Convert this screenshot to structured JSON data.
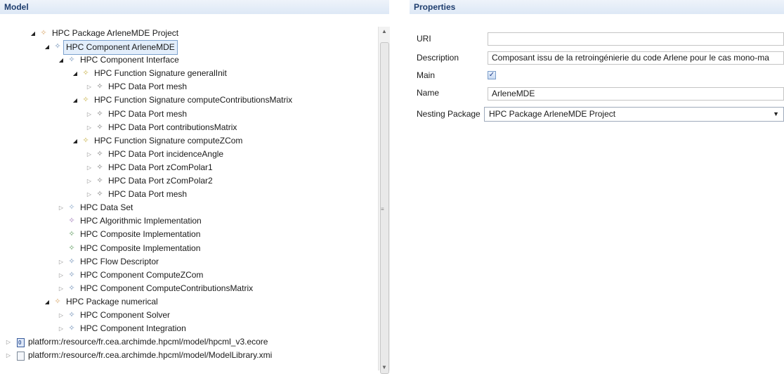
{
  "model_panel": {
    "title": "Model"
  },
  "properties_panel": {
    "title": "Properties",
    "uri": {
      "label": "URI",
      "value": ""
    },
    "description": {
      "label": "Description",
      "value": "Composant issu de la retroingénierie du code Arlene pour le cas mono-ma"
    },
    "main": {
      "label": "Main",
      "checked": true,
      "check_glyph": "✓"
    },
    "name": {
      "label": "Name",
      "value": "ArleneMDE"
    },
    "nesting_package": {
      "label": "Nesting Package",
      "value": "HPC Package ArleneMDE Project",
      "arrow": "▼"
    }
  },
  "tree": [
    {
      "label": "HPC Package ArleneMDE Project",
      "indent": 0,
      "twisty": "open",
      "icon": "package-icon",
      "color": "#d9a86c"
    },
    {
      "label": "HPC Component ArleneMDE",
      "indent": 1,
      "twisty": "open",
      "icon": "component-icon",
      "color": "#6f8fb6",
      "selected": true
    },
    {
      "label": "HPC Component Interface",
      "indent": 2,
      "twisty": "open",
      "icon": "interface-icon",
      "color": "#6f8fb6"
    },
    {
      "label": "HPC Function Signature generalInit",
      "indent": 3,
      "twisty": "open",
      "icon": "signature-icon",
      "color": "#c9b24a"
    },
    {
      "label": "HPC Data Port mesh",
      "indent": 4,
      "twisty": "closed",
      "icon": "port-icon",
      "color": "#7a7a7a"
    },
    {
      "label": "HPC Function Signature computeContributionsMatrix",
      "indent": 3,
      "twisty": "open",
      "icon": "signature-icon",
      "color": "#c9b24a"
    },
    {
      "label": "HPC Data Port mesh",
      "indent": 4,
      "twisty": "closed",
      "icon": "port-icon",
      "color": "#7a7a7a"
    },
    {
      "label": "HPC Data Port contributionsMatrix",
      "indent": 4,
      "twisty": "closed",
      "icon": "port-icon",
      "color": "#7a7a7a"
    },
    {
      "label": "HPC Function Signature computeZCom",
      "indent": 3,
      "twisty": "open",
      "icon": "signature-icon",
      "color": "#c9b24a"
    },
    {
      "label": "HPC Data Port incidenceAngle",
      "indent": 4,
      "twisty": "closed",
      "icon": "port-icon",
      "color": "#7a7a7a"
    },
    {
      "label": "HPC Data Port zComPolar1",
      "indent": 4,
      "twisty": "closed",
      "icon": "port-icon",
      "color": "#7a7a7a"
    },
    {
      "label": "HPC Data Port zComPolar2",
      "indent": 4,
      "twisty": "closed",
      "icon": "port-icon",
      "color": "#7a7a7a"
    },
    {
      "label": "HPC Data Port mesh",
      "indent": 4,
      "twisty": "closed",
      "icon": "port-icon",
      "color": "#7a7a7a"
    },
    {
      "label": "HPC Data Set",
      "indent": 2,
      "twisty": "closed",
      "icon": "dataset-icon",
      "color": "#8aa6c8"
    },
    {
      "label": "HPC Algorithmic Implementation",
      "indent": 2,
      "twisty": "none",
      "icon": "algorithmic-icon",
      "color": "#a07ab8"
    },
    {
      "label": "HPC Composite Implementation",
      "indent": 2,
      "twisty": "none",
      "icon": "composite-icon",
      "color": "#5f9a5f"
    },
    {
      "label": "HPC Composite Implementation",
      "indent": 2,
      "twisty": "none",
      "icon": "composite-icon",
      "color": "#5f9a5f"
    },
    {
      "label": "HPC Flow Descriptor",
      "indent": 2,
      "twisty": "closed",
      "icon": "flow-icon",
      "color": "#6f8fb6"
    },
    {
      "label": "HPC Component ComputeZCom",
      "indent": 2,
      "twisty": "closed",
      "icon": "component-icon",
      "color": "#6f8fb6"
    },
    {
      "label": "HPC Component ComputeContributionsMatrix",
      "indent": 2,
      "twisty": "closed",
      "icon": "component-icon",
      "color": "#6f8fb6"
    },
    {
      "label": "HPC Package numerical",
      "indent": 1,
      "twisty": "open",
      "icon": "package-icon",
      "color": "#d9a86c"
    },
    {
      "label": "HPC Component Solver",
      "indent": 2,
      "twisty": "closed",
      "icon": "component-icon",
      "color": "#6f8fb6"
    },
    {
      "label": "HPC Component Integration",
      "indent": 2,
      "twisty": "closed",
      "icon": "component-icon",
      "color": "#6f8fb6"
    },
    {
      "label": "platform:/resource/fr.cea.archimde.hpcml/model/hpcml_v3.ecore",
      "indent": -1,
      "twisty": "closed",
      "icon": "ecore-file-icon",
      "color": "#3a5d9c"
    },
    {
      "label": "platform:/resource/fr.cea.archimde.hpcml/model/ModelLibrary.xmi",
      "indent": -1,
      "twisty": "closed",
      "icon": "xmi-file-icon",
      "color": "#7d8a99"
    }
  ],
  "glyphs": {
    "open": "◢",
    "closed": "▷",
    "node": "✧",
    "scroll_up": "▲",
    "scroll_down": "▼",
    "grip": "≡"
  }
}
